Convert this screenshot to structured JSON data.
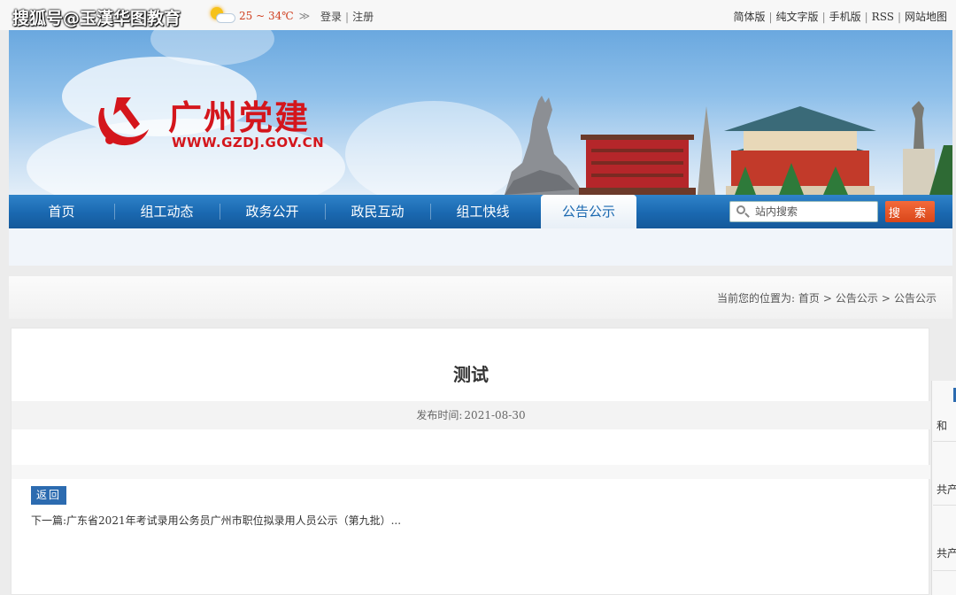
{
  "watermark": {
    "text": "搜狐号@玉漢华图教育"
  },
  "topbar": {
    "weather_temp": "25 ~ 34℃",
    "weather_arrow": "≫",
    "login": "登录",
    "register": "注册",
    "links": [
      "简体版",
      "纯文字版",
      "手机版",
      "RSS",
      "网站地图"
    ]
  },
  "banner": {
    "title": "广州党建",
    "url": "WWW.GZDJ.GOV.CN"
  },
  "nav": {
    "items": [
      "首页",
      "组工动态",
      "政务公开",
      "政民互动",
      "组工快线",
      "公告公示"
    ],
    "active_index": 5,
    "search_placeholder": "站内搜索",
    "search_button": "搜 索"
  },
  "breadcrumb": {
    "prefix": "当前您的位置为:",
    "items": [
      "首页",
      "公告公示",
      "公告公示"
    ],
    "separator": ">"
  },
  "article": {
    "title": "测试",
    "publish_label": "发布时间:",
    "publish_date": "2021-08-30",
    "back_button": "返回",
    "next_label": "下一篇:",
    "next_title": "广东省2021年考试录用公务员广州市职位拟录用人员公示（第九批）..."
  },
  "side": {
    "texts": [
      "和",
      "共产",
      "共产"
    ]
  },
  "colors": {
    "brand_red": "#d4161c",
    "nav_blue": "#1a68b0",
    "search_orange": "#e0501f"
  }
}
